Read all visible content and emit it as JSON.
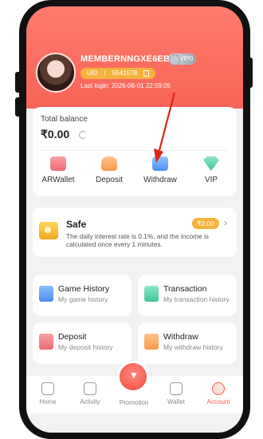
{
  "profile": {
    "username": "MEMBERNNGXE6EB",
    "vip_label": "VIP0",
    "uid_label": "UID",
    "uid_value": "5541578",
    "last_login": "Last login: 2026-06-01 22:59:05"
  },
  "balance": {
    "title": "Total balance",
    "amount": "₹0.00"
  },
  "actions": [
    {
      "label": "ARWallet",
      "icon": "wallet-icon"
    },
    {
      "label": "Deposit",
      "icon": "deposit-icon"
    },
    {
      "label": "Withdraw",
      "icon": "withdraw-icon"
    },
    {
      "label": "VIP",
      "icon": "vip-icon"
    }
  ],
  "safe": {
    "title": "Safe",
    "amount": "₹0.00",
    "description": "The daily interest rate is 0.1%, and the income is calculated once every 1 minutes."
  },
  "menu": [
    {
      "title": "Game History",
      "subtitle": "My game history"
    },
    {
      "title": "Transaction",
      "subtitle": "My transaction history"
    },
    {
      "title": "Deposit",
      "subtitle": "My deposit history"
    },
    {
      "title": "Withdraw",
      "subtitle": "My withdraw history"
    }
  ],
  "nav": {
    "home": "Home",
    "activity": "Activity",
    "promotion": "Promotion",
    "wallet": "Wallet",
    "account": "Account"
  },
  "colors": {
    "header": "#f76457",
    "accent_gold": "#f7b23b",
    "arrow": "#e0241b"
  }
}
